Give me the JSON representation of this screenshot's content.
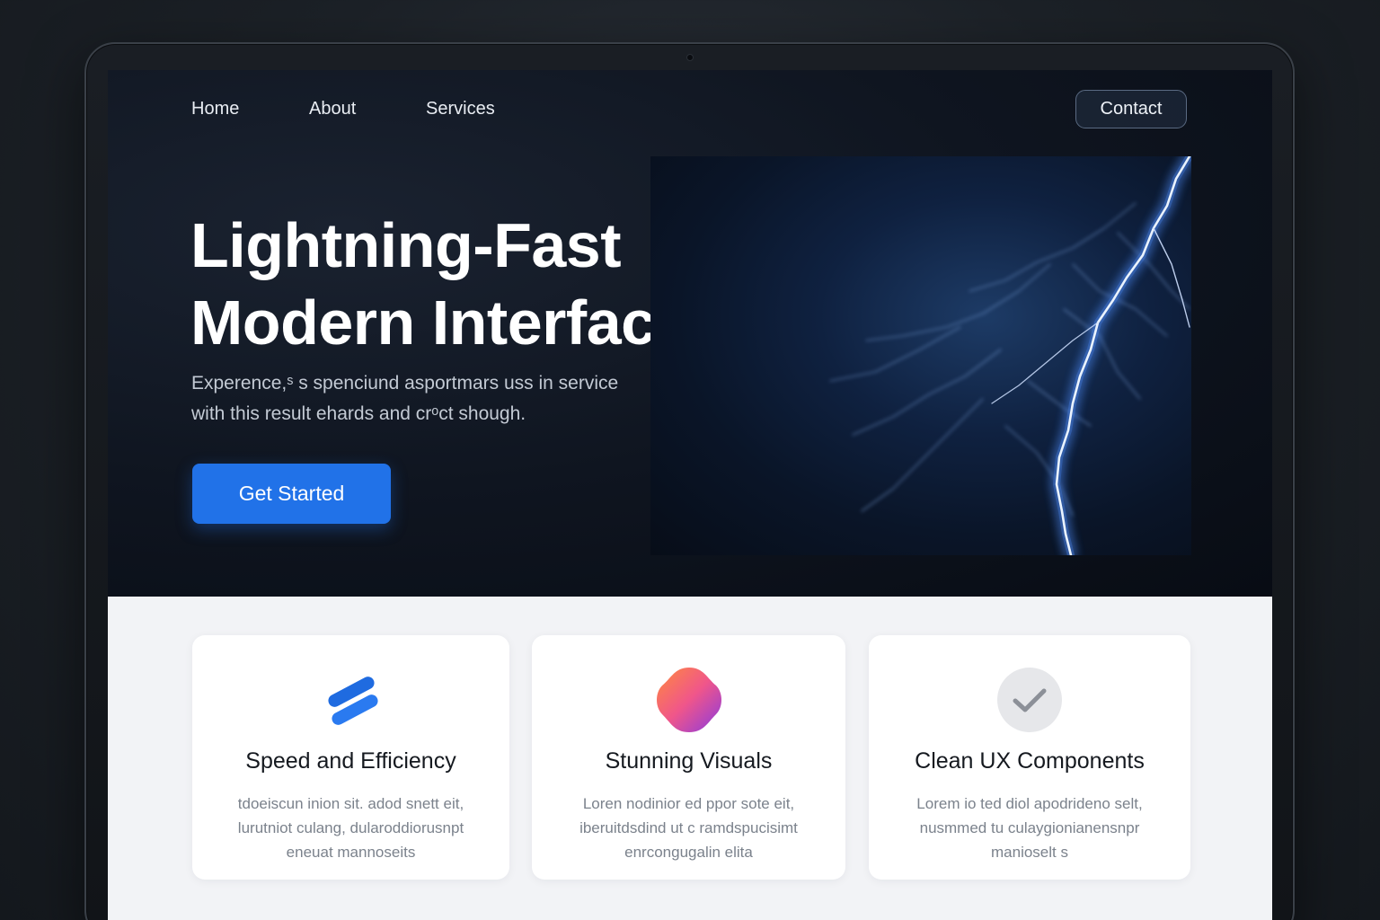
{
  "nav": {
    "links": [
      "Home",
      "About",
      "Services"
    ],
    "contact_label": "Contact"
  },
  "hero": {
    "title_line1": "Lightning-Fast",
    "title_line2": "Modern Interface",
    "subtitle_line1": "Experence,ˢ s spenciund asportmars uss in service",
    "subtitle_line2": "with this result ehards and crᵒct shough.",
    "cta_label": "Get Started"
  },
  "features": [
    {
      "icon": "speed-stripes-icon",
      "title": "Speed and Efficiency",
      "text_lines": [
        "tdoeiscun inion sit. adod snett eit,",
        "lurutniot culang, dularoddiorusnpt",
        "eneuat mannoseits"
      ]
    },
    {
      "icon": "gradient-blob-icon",
      "title": "Stunning Visuals",
      "text_lines": [
        "Loren nodinior ed ppor sote eit,",
        "iberuitdsdind ut c ramdspucisimt",
        "enrcongugalin elita"
      ]
    },
    {
      "icon": "checkmark-circle-icon",
      "title": "Clean UX Components",
      "text_lines": [
        "Lorem io ted diol apodrideno selt,",
        "nusmmed tu culaygionianensnpr",
        "manioselt s"
      ]
    }
  ],
  "colors": {
    "accent": "#2172e8",
    "hero_bg": "#0c1119",
    "card_bg": "#ffffff"
  }
}
